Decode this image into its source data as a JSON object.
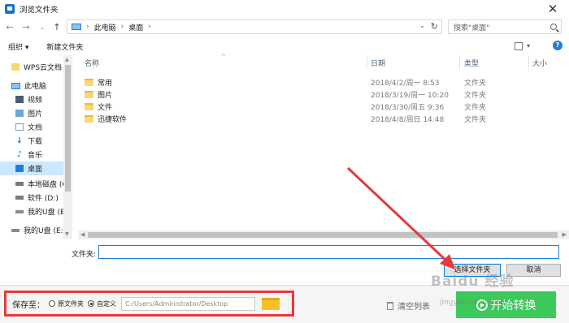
{
  "window": {
    "title": "浏览文件夹",
    "close_glyph": "✕"
  },
  "address": {
    "back_glyph": "←",
    "forward_glyph": "→",
    "recent_glyph": "⌄",
    "up_glyph": "↑",
    "crumbs": [
      "此电脑",
      "桌面"
    ],
    "sep_glyph": "›",
    "dropdown_glyph": "⌄",
    "refresh_glyph": "↻",
    "search_placeholder": "搜索\"桌面\""
  },
  "toolbar": {
    "organize_label": "组织 ▾",
    "new_folder_label": "新建文件夹",
    "view_dd_glyph": "▾",
    "help_glyph": "?"
  },
  "nav": {
    "items": [
      {
        "label": "WPS云文档",
        "icon": "folder-icon"
      },
      {
        "label": "此电脑",
        "icon": "pc-icon"
      },
      {
        "label": "视频",
        "icon": "video-icon"
      },
      {
        "label": "图片",
        "icon": "picture-icon"
      },
      {
        "label": "文档",
        "icon": "document-icon"
      },
      {
        "label": "下载",
        "icon": "download-icon"
      },
      {
        "label": "音乐",
        "icon": "music-icon"
      },
      {
        "label": "桌面",
        "icon": "desktop-icon"
      },
      {
        "label": "本地磁盘 (C",
        "icon": "disk-icon"
      },
      {
        "label": "软件 (D:)",
        "icon": "disk-icon"
      },
      {
        "label": "我的U盘 (E",
        "icon": "usb-icon"
      },
      {
        "label": "我的U盘 (E:)",
        "icon": "usb-icon"
      }
    ],
    "download_glyph": "↓",
    "music_glyph": "♪",
    "scroll_up": "▲",
    "scroll_down": "▼"
  },
  "files": {
    "columns": {
      "name": "名称",
      "date": "日期",
      "type": "类型",
      "size": "大小"
    },
    "sort_glyph": "^",
    "rows": [
      {
        "name": "常用",
        "date": "2018/4/2/周一 8:53",
        "type": "文件夹"
      },
      {
        "name": "图片",
        "date": "2018/3/19/周一 10:20",
        "type": "文件夹"
      },
      {
        "name": "文件",
        "date": "2018/3/30/周五 9:36",
        "type": "文件夹"
      },
      {
        "name": "迅捷软件",
        "date": "2018/4/8/周日 14:48",
        "type": "文件夹"
      }
    ],
    "hscroll_left": "◀",
    "hscroll_right": "▶"
  },
  "folder_field": {
    "label": "文件夹:",
    "value": ""
  },
  "buttons": {
    "select_folder": "选择文件夹",
    "cancel": "取消"
  },
  "bottom": {
    "save_to_label": "保存至：",
    "option_original": "原文件夹",
    "option_custom": "自定义",
    "custom_selected": true,
    "path_value": "C:/Users/Administrator/Desktop",
    "clear_list": "清空列表",
    "start_convert": "开始转换"
  },
  "watermark": {
    "text": "Baidu 经验",
    "sub": "jingyan.baidu.com"
  },
  "colors": {
    "accent": "#1e7fd6",
    "annotation_red": "#e53a3a",
    "start_green": "#3cc85a",
    "folder_yellow": "#f8d775"
  }
}
